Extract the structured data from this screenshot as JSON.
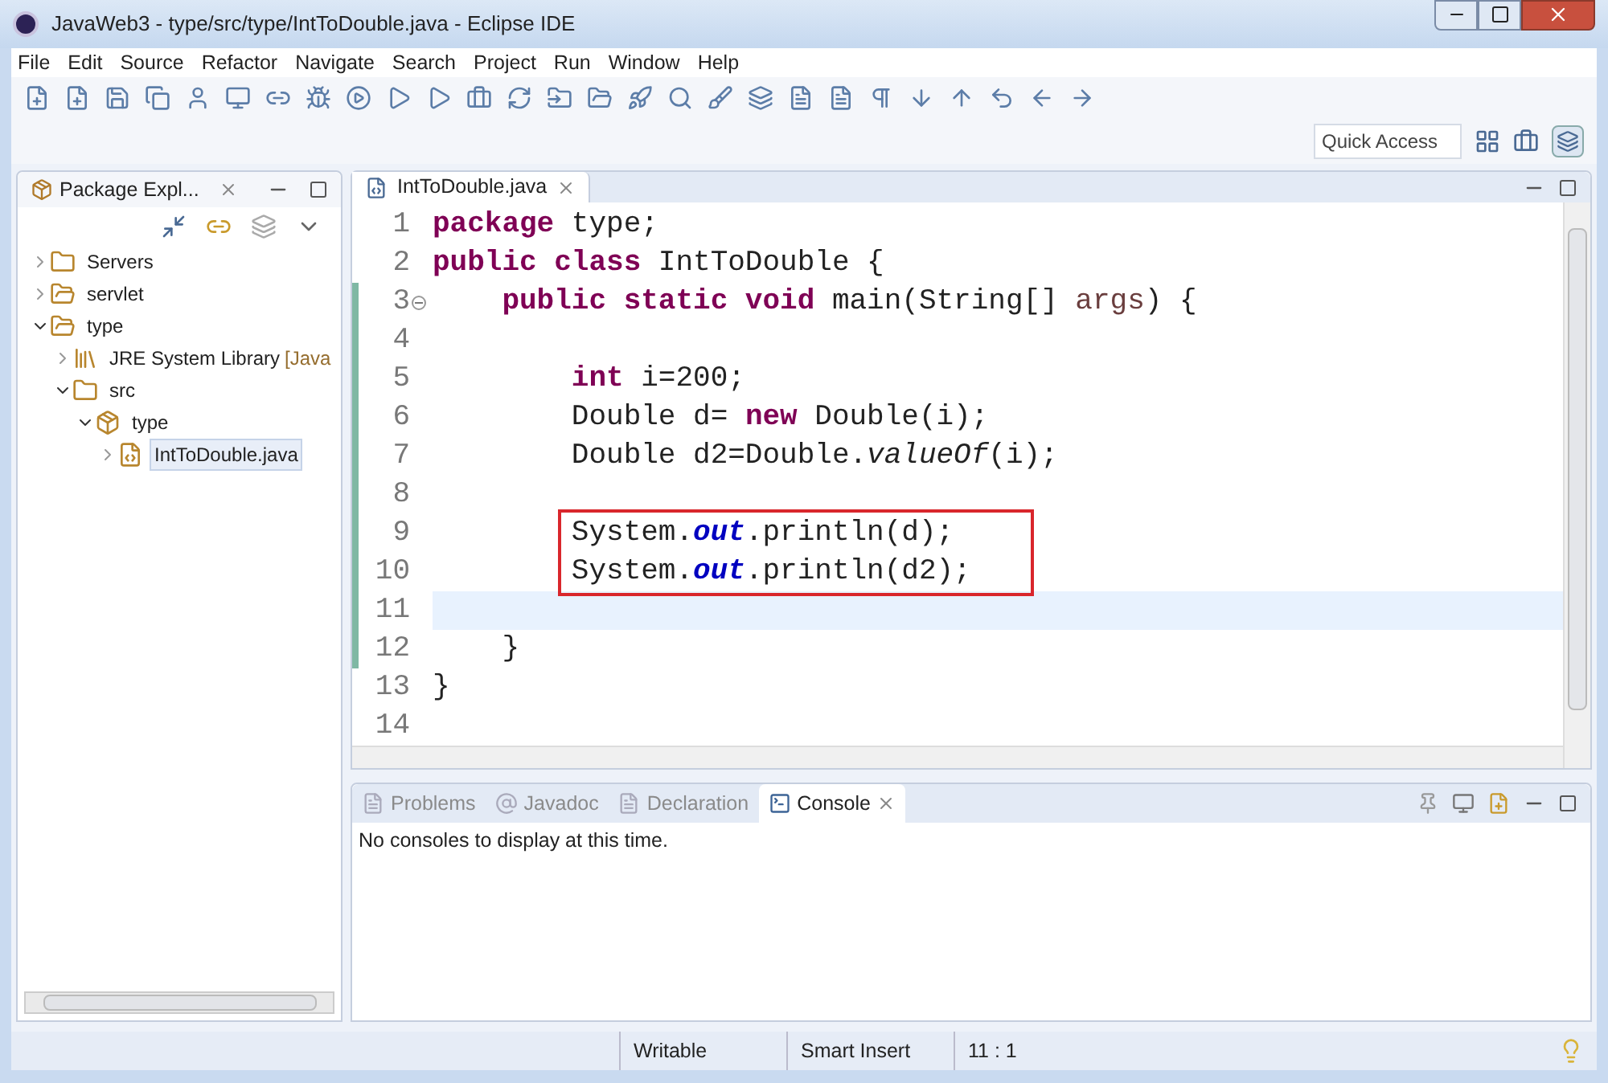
{
  "window": {
    "title": "JavaWeb3 - type/src/type/IntToDouble.java - Eclipse IDE"
  },
  "menu": [
    "File",
    "Edit",
    "Source",
    "Refactor",
    "Navigate",
    "Search",
    "Project",
    "Run",
    "Window",
    "Help"
  ],
  "quick_access": {
    "placeholder": "Quick Access"
  },
  "package_explorer": {
    "title": "Package Expl...",
    "tree": [
      {
        "label": "Servers",
        "kind": "folder",
        "expanded": false,
        "selected": false
      },
      {
        "label": "servlet",
        "kind": "project",
        "expanded": false,
        "selected": false
      },
      {
        "label": "type",
        "kind": "project",
        "expanded": true,
        "selected": false,
        "children": [
          {
            "label": "JRE System Library",
            "decoration": "[Java",
            "kind": "library",
            "expanded": false,
            "selected": false
          },
          {
            "label": "src",
            "kind": "folder",
            "expanded": true,
            "selected": false,
            "children": [
              {
                "label": "type",
                "kind": "package",
                "expanded": true,
                "selected": false,
                "children": [
                  {
                    "label": "IntToDouble.java",
                    "kind": "java",
                    "expanded": false,
                    "selected": true
                  }
                ]
              }
            ]
          }
        ]
      }
    ]
  },
  "editor": {
    "tab": "IntToDouble.java",
    "lines": [
      {
        "number": "1",
        "changed": false,
        "fold": false,
        "current": false,
        "boxed": false,
        "tokens": [
          {
            "kind": "keyword",
            "text": "package"
          },
          {
            "kind": "plain",
            "text": " type;"
          }
        ]
      },
      {
        "number": "2",
        "changed": false,
        "fold": false,
        "current": false,
        "boxed": false,
        "tokens": [
          {
            "kind": "keyword",
            "text": "public class"
          },
          {
            "kind": "plain",
            "text": " IntToDouble {"
          }
        ]
      },
      {
        "number": "3",
        "changed": true,
        "fold": true,
        "current": false,
        "boxed": false,
        "tokens": [
          {
            "kind": "keyword",
            "text": "    public static void"
          },
          {
            "kind": "plain",
            "text": " main(String[] "
          },
          {
            "kind": "param",
            "text": "args"
          },
          {
            "kind": "plain",
            "text": ") {"
          }
        ]
      },
      {
        "number": "4",
        "changed": true,
        "fold": false,
        "current": false,
        "boxed": false
      },
      {
        "number": "5",
        "changed": true,
        "fold": false,
        "current": false,
        "boxed": false,
        "tokens": [
          {
            "kind": "keyword",
            "text": "        int"
          },
          {
            "kind": "plain",
            "text": " i=200;"
          }
        ]
      },
      {
        "number": "6",
        "changed": true,
        "fold": false,
        "current": false,
        "boxed": false,
        "tokens": [
          {
            "kind": "plain",
            "text": "        Double d= "
          },
          {
            "kind": "keyword",
            "text": "new"
          },
          {
            "kind": "plain",
            "text": " Double(i);"
          }
        ]
      },
      {
        "number": "7",
        "changed": true,
        "fold": false,
        "current": false,
        "boxed": false,
        "tokens": [
          {
            "kind": "plain",
            "text": "        Double d2=Double."
          },
          {
            "kind": "method",
            "text": "valueOf"
          },
          {
            "kind": "plain",
            "text": "(i);"
          }
        ]
      },
      {
        "number": "8",
        "changed": true,
        "fold": false,
        "current": false,
        "boxed": false
      },
      {
        "number": "9",
        "changed": true,
        "fold": false,
        "current": false,
        "boxed": true,
        "tokens": [
          {
            "kind": "plain",
            "text": "        System."
          },
          {
            "kind": "field",
            "text": "out"
          },
          {
            "kind": "plain",
            "text": ".println(d);"
          }
        ]
      },
      {
        "number": "10",
        "changed": true,
        "fold": false,
        "current": false,
        "boxed": true,
        "tokens": [
          {
            "kind": "plain",
            "text": "        System."
          },
          {
            "kind": "field",
            "text": "out"
          },
          {
            "kind": "plain",
            "text": ".println(d2);"
          }
        ]
      },
      {
        "number": "11",
        "changed": true,
        "fold": false,
        "current": true,
        "boxed": false
      },
      {
        "number": "12",
        "changed": true,
        "fold": false,
        "current": false,
        "boxed": false,
        "tokens": [
          {
            "kind": "plain",
            "text": "    }"
          }
        ]
      },
      {
        "number": "13",
        "changed": false,
        "fold": false,
        "current": false,
        "boxed": false,
        "tokens": [
          {
            "kind": "plain",
            "text": "}"
          }
        ]
      },
      {
        "number": "14",
        "changed": false,
        "fold": false,
        "current": false,
        "boxed": false
      }
    ]
  },
  "bottom_panel": {
    "tabs": [
      {
        "label": "Problems",
        "selected": false
      },
      {
        "label": "Javadoc",
        "selected": false
      },
      {
        "label": "Declaration",
        "selected": false
      },
      {
        "label": "Console",
        "selected": true
      }
    ],
    "message": "No consoles to display at this time."
  },
  "status_bar": [
    "Writable",
    "Smart Insert",
    "11 : 1"
  ]
}
